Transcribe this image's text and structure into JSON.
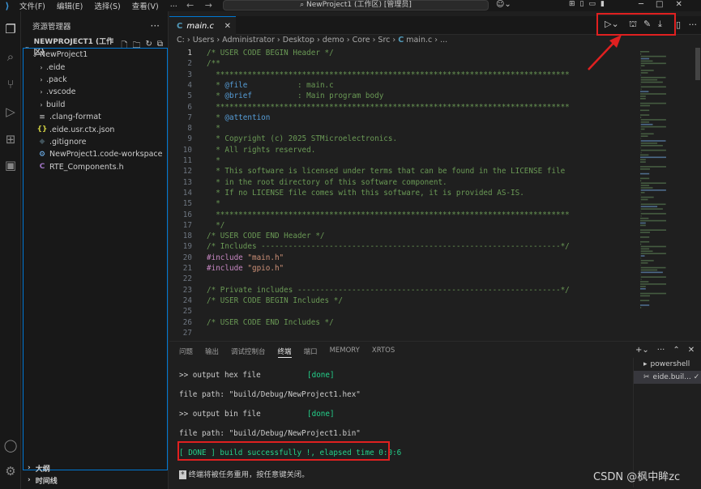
{
  "titlebar": {
    "menus": [
      "文件(F)",
      "编辑(E)",
      "选择(S)",
      "查看(V)",
      "..."
    ],
    "search": "NewProject1 (工作区) [管理员]"
  },
  "sidebar": {
    "title": "资源管理器",
    "project": "NEWPROJECT1 (工作区)",
    "root": "NewProject1",
    "items": [
      {
        "label": ".eide",
        "kind": "folder"
      },
      {
        "label": ".pack",
        "kind": "folder"
      },
      {
        "label": ".vscode",
        "kind": "folder"
      },
      {
        "label": "build",
        "kind": "folder"
      },
      {
        "label": ".clang-format",
        "kind": "config"
      },
      {
        "label": ".eide.usr.ctx.json",
        "kind": "json"
      },
      {
        "label": ".gitignore",
        "kind": "git"
      },
      {
        "label": "NewProject1.code-workspace",
        "kind": "workspace"
      },
      {
        "label": "RTE_Components.h",
        "kind": "c"
      }
    ],
    "outline": "大纲",
    "timeline": "时间线"
  },
  "editor": {
    "tab": "main.c",
    "breadcrumb": [
      "C:",
      "Users",
      "Administrator",
      "Desktop",
      "demo",
      "Core",
      "Src",
      "main.c",
      "..."
    ],
    "lines": [
      [
        {
          "t": "/* USER CODE BEGIN Header */",
          "c": "cm"
        }
      ],
      [
        {
          "t": "/**",
          "c": "cm"
        }
      ],
      [
        {
          "t": "  ******************************************************************************",
          "c": "cm"
        }
      ],
      [
        {
          "t": "  * ",
          "c": "cm"
        },
        {
          "t": "@file",
          "c": "dk"
        },
        {
          "t": "           : main.c",
          "c": "cm"
        }
      ],
      [
        {
          "t": "  * ",
          "c": "cm"
        },
        {
          "t": "@brief",
          "c": "dk"
        },
        {
          "t": "          : Main program body",
          "c": "cm"
        }
      ],
      [
        {
          "t": "  ******************************************************************************",
          "c": "cm"
        }
      ],
      [
        {
          "t": "  * ",
          "c": "cm"
        },
        {
          "t": "@attention",
          "c": "dk"
        }
      ],
      [
        {
          "t": "  *",
          "c": "cm"
        }
      ],
      [
        {
          "t": "  * Copyright (c) 2025 STMicroelectronics.",
          "c": "cm"
        }
      ],
      [
        {
          "t": "  * All rights reserved.",
          "c": "cm"
        }
      ],
      [
        {
          "t": "  *",
          "c": "cm"
        }
      ],
      [
        {
          "t": "  * This software is licensed under terms that can be found in the LICENSE file",
          "c": "cm"
        }
      ],
      [
        {
          "t": "  * in the root directory of this software component.",
          "c": "cm"
        }
      ],
      [
        {
          "t": "  * If no LICENSE file comes with this software, it is provided AS-IS.",
          "c": "cm"
        }
      ],
      [
        {
          "t": "  *",
          "c": "cm"
        }
      ],
      [
        {
          "t": "  ******************************************************************************",
          "c": "cm"
        }
      ],
      [
        {
          "t": "  */",
          "c": "cm"
        }
      ],
      [
        {
          "t": "/* USER CODE END Header */",
          "c": "cm"
        }
      ],
      [
        {
          "t": "/* Includes ------------------------------------------------------------------*/",
          "c": "cm"
        }
      ],
      [
        {
          "t": "#include ",
          "c": "pp"
        },
        {
          "t": "\"main.h\"",
          "c": "st"
        }
      ],
      [
        {
          "t": "#include ",
          "c": "pp"
        },
        {
          "t": "\"gpio.h\"",
          "c": "st"
        }
      ],
      [
        {
          "t": "",
          "c": "cm"
        }
      ],
      [
        {
          "t": "/* Private includes ----------------------------------------------------------*/",
          "c": "cm"
        }
      ],
      [
        {
          "t": "/* USER CODE BEGIN Includes */",
          "c": "cm"
        }
      ],
      [
        {
          "t": "",
          "c": "cm"
        }
      ],
      [
        {
          "t": "/* USER CODE END Includes */",
          "c": "cm"
        }
      ],
      [
        {
          "t": "",
          "c": "cm"
        }
      ]
    ]
  },
  "panel": {
    "tabs": [
      "问题",
      "输出",
      "调试控制台",
      "终端",
      "端口",
      "MEMORY",
      "XRTOS"
    ],
    "active_tab": "终端",
    "terminal": [
      {
        "a": ">> output hex file",
        "b": "[done]"
      },
      {
        "a": "file path: \"build/Debug/NewProject1.hex\"",
        "b": ""
      },
      {
        "a": ">> output bin file",
        "b": "[done]"
      },
      {
        "a": "file path: \"build/Debug/NewProject1.bin\"",
        "b": ""
      }
    ],
    "done_open": "[ ",
    "done_word": "DONE",
    "done_rest": " ] build successfully !, elapsed time 0:0:6",
    "reuse_note": "终端将被任务重用，按任意键关闭。",
    "terminals": [
      "powershell",
      "eide.buil..."
    ]
  },
  "watermark": "CSDN @枫中眸zc",
  "colors": {
    "accent": "#0078d4",
    "highlight": "#e02020",
    "success": "#23d18b"
  }
}
